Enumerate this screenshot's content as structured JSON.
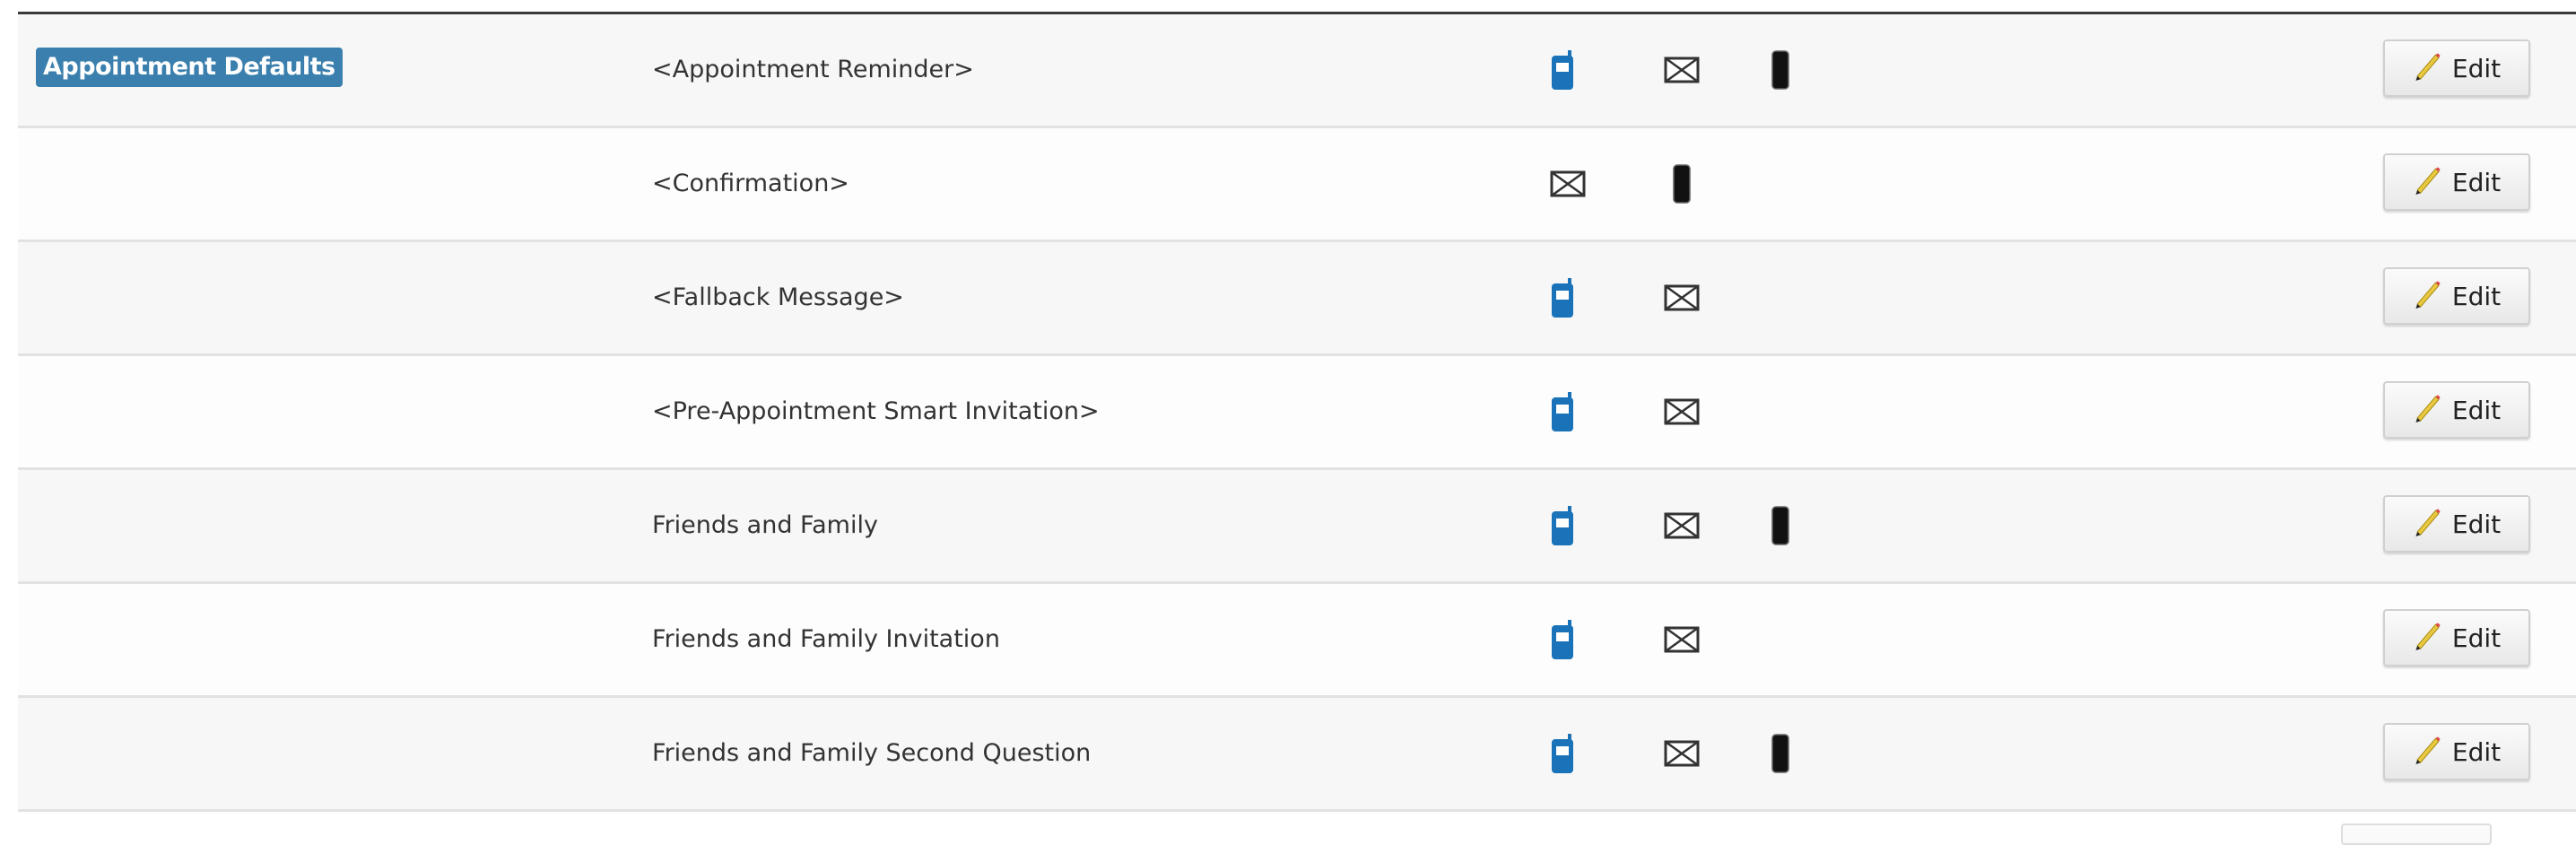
{
  "group_label": "Appointment Defaults",
  "edit_label": "Edit",
  "colors": {
    "badge": "#3a7fad",
    "sms_icon": "#1a73b8",
    "phone_icon": "#111111"
  },
  "rows": [
    {
      "name": "<Appointment Reminder>",
      "icons": [
        "sms-icon",
        "email-icon",
        "phone-icon"
      ]
    },
    {
      "name": "<Confirmation>",
      "icons": [
        "email-icon",
        "phone-icon"
      ]
    },
    {
      "name": "<Fallback Message>",
      "icons": [
        "sms-icon",
        "email-icon"
      ]
    },
    {
      "name": "<Pre-Appointment Smart Invitation>",
      "icons": [
        "sms-icon",
        "email-icon"
      ]
    },
    {
      "name": "Friends and Family",
      "icons": [
        "sms-icon",
        "email-icon",
        "phone-icon"
      ]
    },
    {
      "name": "Friends and Family Invitation",
      "icons": [
        "sms-icon",
        "email-icon"
      ]
    },
    {
      "name": "Friends and Family Second Question",
      "icons": [
        "sms-icon",
        "email-icon",
        "phone-icon"
      ]
    }
  ]
}
